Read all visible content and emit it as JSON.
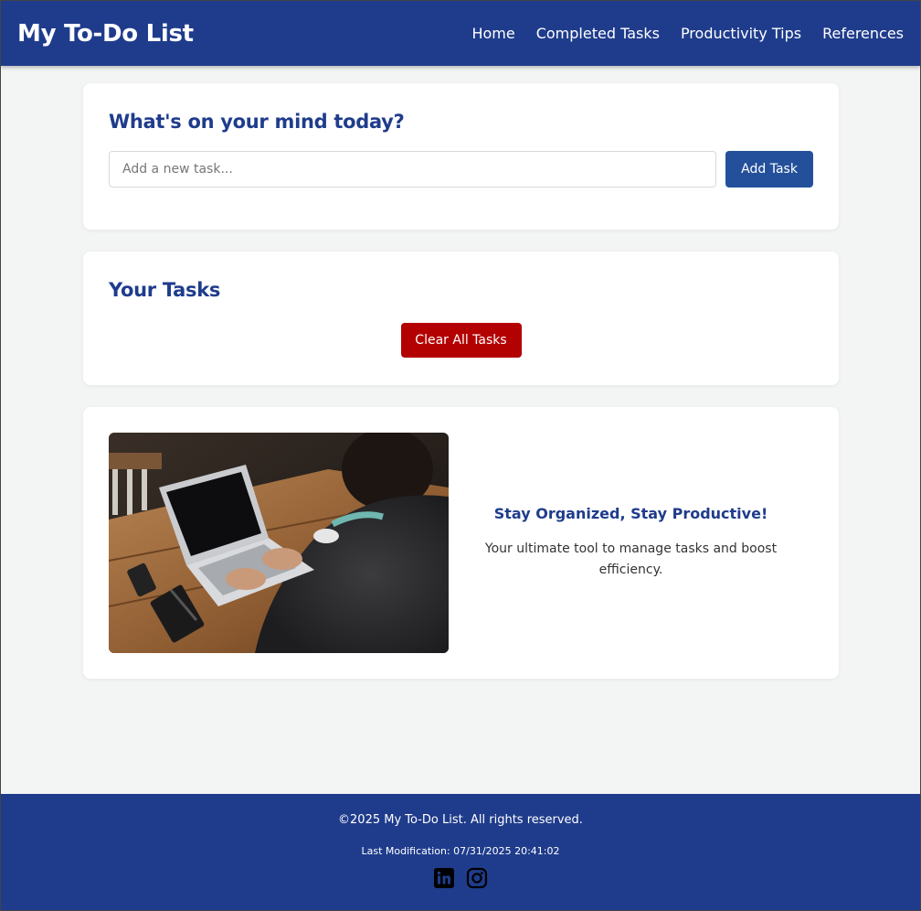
{
  "header": {
    "title": "My To-Do List",
    "nav": [
      "Home",
      "Completed Tasks",
      "Productivity Tips",
      "References"
    ]
  },
  "add_card": {
    "heading": "What's on your mind today?",
    "input_placeholder": "Add a new task...",
    "input_value": "",
    "add_button": "Add Task"
  },
  "tasks_card": {
    "heading": "Your Tasks",
    "clear_button": "Clear All Tasks"
  },
  "promo_card": {
    "image_subject": "person-typing-on-laptop",
    "heading": "Stay Organized, Stay Productive!",
    "body": "Your ultimate tool to manage tasks and boost efficiency."
  },
  "footer": {
    "copyright": "©2025 My To-Do List. All rights reserved.",
    "last_modification": "Last Modification: 07/31/2025 20:41:02",
    "social_icons": [
      "linkedin-icon",
      "instagram-icon"
    ]
  },
  "colors": {
    "brand": "#1f3c8c",
    "button": "#24509b",
    "danger": "#b30000",
    "background": "#f3f4f4"
  }
}
